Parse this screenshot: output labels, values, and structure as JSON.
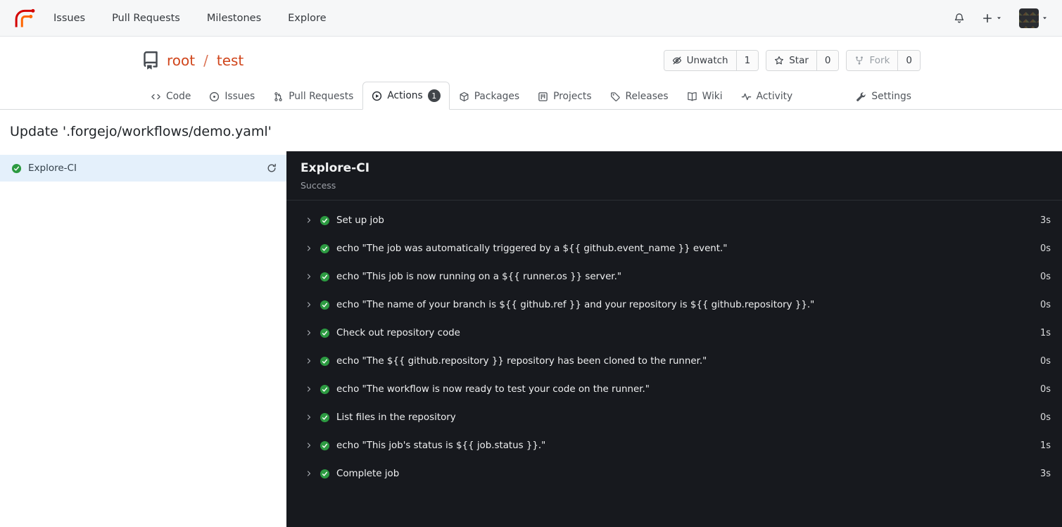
{
  "colors": {
    "accent_link": "#d0451b",
    "success_green": "#2c9a41",
    "log_panel_bg": "#17191e",
    "active_job_bg": "#e4f0fb",
    "tab_badge_bg": "#41454a"
  },
  "navbar": {
    "items": [
      "Issues",
      "Pull Requests",
      "Milestones",
      "Explore"
    ]
  },
  "repo": {
    "owner": "root",
    "separator": "/",
    "name": "test",
    "actions": {
      "unwatch": {
        "label": "Unwatch",
        "count": "1"
      },
      "star": {
        "label": "Star",
        "count": "0"
      },
      "fork": {
        "label": "Fork",
        "count": "0"
      }
    }
  },
  "tabs": {
    "code": {
      "label": "Code"
    },
    "issues": {
      "label": "Issues"
    },
    "pull_requests": {
      "label": "Pull Requests"
    },
    "actions": {
      "label": "Actions",
      "badge": "1"
    },
    "packages": {
      "label": "Packages"
    },
    "projects": {
      "label": "Projects"
    },
    "releases": {
      "label": "Releases"
    },
    "wiki": {
      "label": "Wiki"
    },
    "activity": {
      "label": "Activity"
    },
    "settings": {
      "label": "Settings"
    }
  },
  "run": {
    "title": "Update '.forgejo/workflows/demo.yaml'"
  },
  "sidebar": {
    "job": {
      "name": "Explore-CI",
      "status": "success"
    }
  },
  "log": {
    "title": "Explore-CI",
    "status": "Success",
    "steps": [
      {
        "name": "Set up job",
        "duration": "3s"
      },
      {
        "name": "echo \"The job was automatically triggered by a ${{ github.event_name }} event.\"",
        "duration": "0s"
      },
      {
        "name": "echo \"This job is now running on a ${{ runner.os }} server.\"",
        "duration": "0s"
      },
      {
        "name": "echo \"The name of your branch is ${{ github.ref }} and your repository is ${{ github.repository }}.\"",
        "duration": "0s"
      },
      {
        "name": "Check out repository code",
        "duration": "1s"
      },
      {
        "name": "echo \"The ${{ github.repository }} repository has been cloned to the runner.\"",
        "duration": "0s"
      },
      {
        "name": "echo \"The workflow is now ready to test your code on the runner.\"",
        "duration": "0s"
      },
      {
        "name": "List files in the repository",
        "duration": "0s"
      },
      {
        "name": "echo \"This job's status is ${{ job.status }}.\"",
        "duration": "1s"
      },
      {
        "name": "Complete job",
        "duration": "3s"
      }
    ]
  }
}
